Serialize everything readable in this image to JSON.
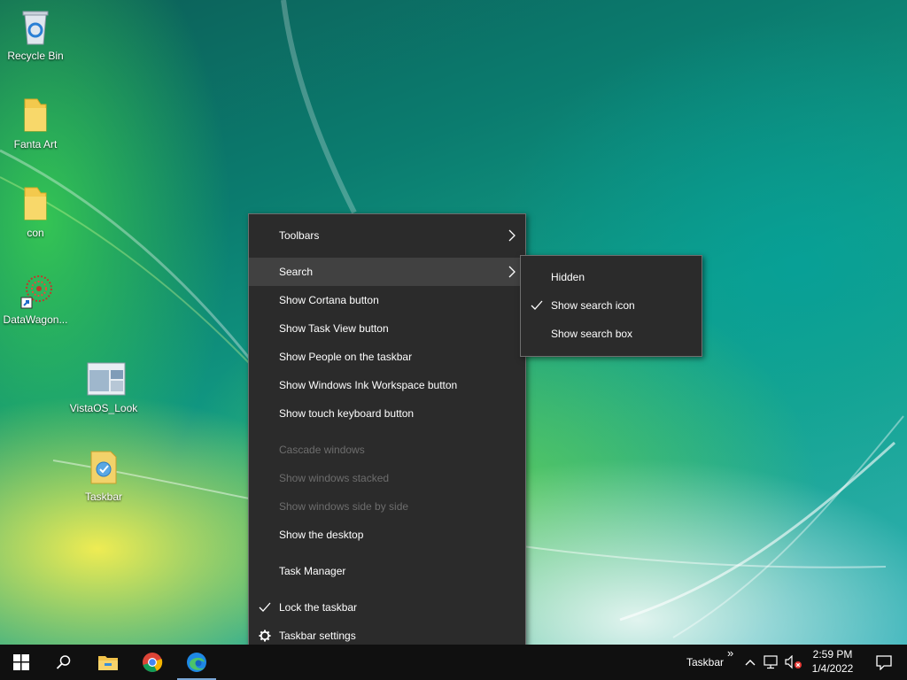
{
  "desktop": {
    "icons": [
      {
        "label": "Recycle Bin"
      },
      {
        "label": "Fanta Art"
      },
      {
        "label": "con"
      },
      {
        "label": "DataWagon..."
      },
      {
        "label": "VistaOS_Look"
      },
      {
        "label": "Taskbar"
      }
    ]
  },
  "context_menu": {
    "items": [
      {
        "label": "Toolbars"
      },
      {
        "label": "Search"
      },
      {
        "label": "Show Cortana button"
      },
      {
        "label": "Show Task View button"
      },
      {
        "label": "Show People on the taskbar"
      },
      {
        "label": "Show Windows Ink Workspace button"
      },
      {
        "label": "Show touch keyboard button"
      },
      {
        "label": "Cascade windows"
      },
      {
        "label": "Show windows stacked"
      },
      {
        "label": "Show windows side by side"
      },
      {
        "label": "Show the desktop"
      },
      {
        "label": "Task Manager"
      },
      {
        "label": "Lock the taskbar"
      },
      {
        "label": "Taskbar settings"
      }
    ],
    "chevron": "›"
  },
  "search_submenu": {
    "items": [
      {
        "label": "Hidden"
      },
      {
        "label": "Show search icon"
      },
      {
        "label": "Show search box"
      }
    ]
  },
  "taskbar": {
    "toolbar_label": "Taskbar",
    "overflow": "»",
    "time": "2:59 PM",
    "date": "1/4/2022"
  },
  "colors": {
    "menu_bg": "#2b2b2b",
    "menu_highlight": "#414141",
    "taskbar_bg": "#101010",
    "disabled_text": "#6d6d6d"
  }
}
